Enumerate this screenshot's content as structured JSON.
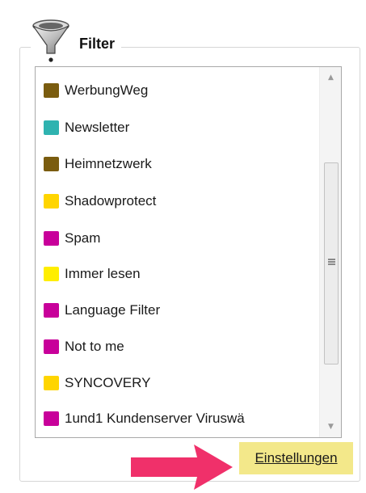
{
  "panel": {
    "title": "Filter",
    "icon": "funnel-icon"
  },
  "filters": [
    {
      "label": "WerbungWeg",
      "color": "#7a5c0f"
    },
    {
      "label": "Newsletter",
      "color": "#2fb3b0"
    },
    {
      "label": "Heimnetzwerk",
      "color": "#7a5c0f"
    },
    {
      "label": "Shadowprotect",
      "color": "#ffd500"
    },
    {
      "label": "Spam",
      "color": "#c8009a"
    },
    {
      "label": "Immer lesen",
      "color": "#ffee00"
    },
    {
      "label": "Language Filter",
      "color": "#c8009a"
    },
    {
      "label": "Not to me",
      "color": "#c8009a"
    },
    {
      "label": "SYNCOVERY",
      "color": "#ffd500"
    },
    {
      "label": "1und1 Kundenserver Viruswä",
      "color": "#c8009a"
    }
  ],
  "settings_link": {
    "label": "Einstellungen",
    "highlight_color": "#f3e88a"
  },
  "annotation": {
    "arrow_color": "#f0306a",
    "icon": "arrow-right-icon"
  }
}
